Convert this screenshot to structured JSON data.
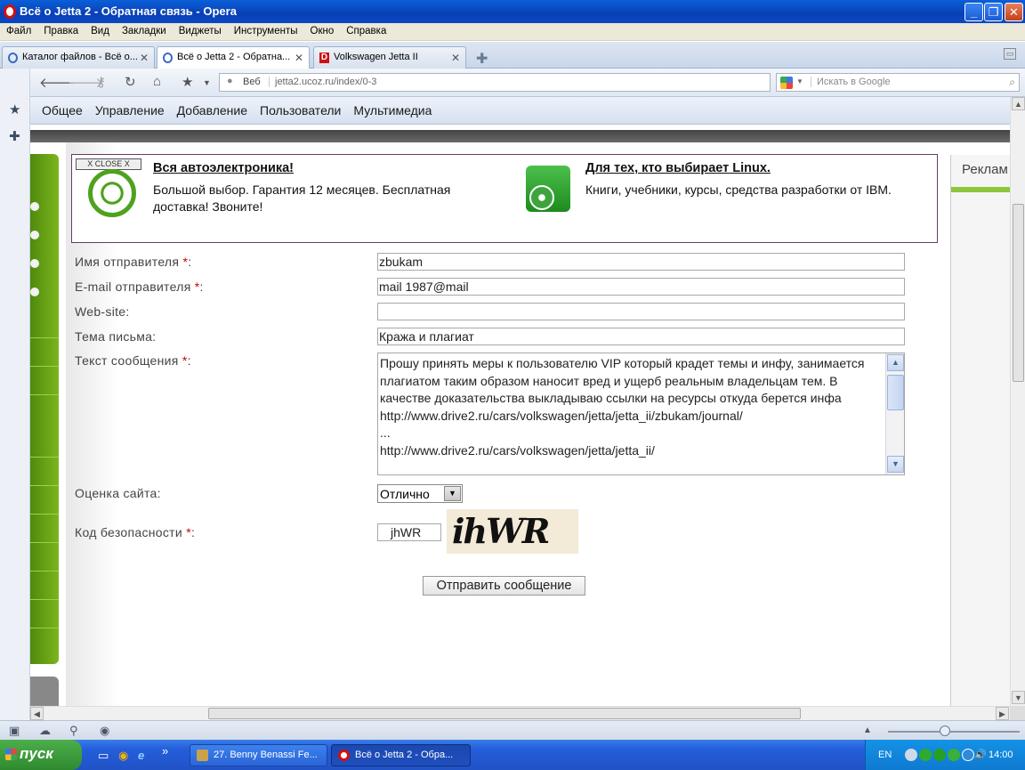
{
  "window": {
    "title": "Всё о Jetta 2 - Обратная связь - Opera"
  },
  "menu": [
    "Файл",
    "Правка",
    "Вид",
    "Закладки",
    "Виджеты",
    "Инструменты",
    "Окно",
    "Справка"
  ],
  "tabs": [
    {
      "label": "Каталог файлов - Всё о...",
      "active": false
    },
    {
      "label": "Всё о Jetta 2 - Обратна...",
      "active": true
    },
    {
      "label": "Volkswagen Jetta II",
      "active": false
    }
  ],
  "nav": {
    "web_label": "Веб",
    "url": "jetta2.ucoz.ru/index/0-3",
    "search_placeholder": "Искать в Google"
  },
  "bookmarks": [
    "Общее",
    "Управление",
    "Добавление",
    "Пользователи",
    "Мультимедиа"
  ],
  "ads": {
    "close_label": "X CLOSE X",
    "ad1_title": "Вся автоэлектроника!",
    "ad1_text": "Большой выбор. Гарантия 12 месяцев. Бесплатная доставка! Звоните!",
    "ad2_title": "Для тех, кто выбирает Linux.",
    "ad2_text": "Книги, учебники, курсы, средства разработки от IBM."
  },
  "right_column": {
    "title": "Реклам"
  },
  "form": {
    "sender_name_label": "Имя отправителя",
    "sender_name_value": "zbukam",
    "sender_email_label": "E-mail отправителя",
    "sender_email_value": "mail 1987@mail",
    "website_label": "Web-site:",
    "website_value": "",
    "subject_label": "Тема письма:",
    "subject_value": "Кража  и плагиат",
    "message_label": "Текст сообщения",
    "message_value": "Прошу принять меры к пользователю VIP который крадет темы и инфу, занимается плагиатом таким образом наносит вред и ущерб реальным владельцам тем. В качестве доказательства выкладываю ссылки на ресурсы откуда берется инфа\nhttp://www.drive2.ru/cars/volkswagen/jetta/jetta_ii/zbukam/journal/\n...\nhttp://www.drive2.ru/cars/volkswagen/jetta/jetta_ii/",
    "rating_label": "Оценка сайта:",
    "rating_value": "Отлично",
    "security_label": "Код безопасности",
    "security_value": "jhWR",
    "captcha_text": "ihWR",
    "submit_label": "Отправить  сообщение",
    "required_mark": "*",
    "colon": ":"
  },
  "taskbar": {
    "start_label": "пуск",
    "overflow": "»",
    "items": [
      {
        "label": "27. Benny Benassi Fe..."
      },
      {
        "label": "Всё о Jetta 2 - Обра..."
      }
    ],
    "lang": "EN",
    "clock": "14:00"
  },
  "colors": {
    "accent_green": "#7bb51e",
    "required_red": "#cc0000",
    "xp_blue": "#245edb"
  }
}
